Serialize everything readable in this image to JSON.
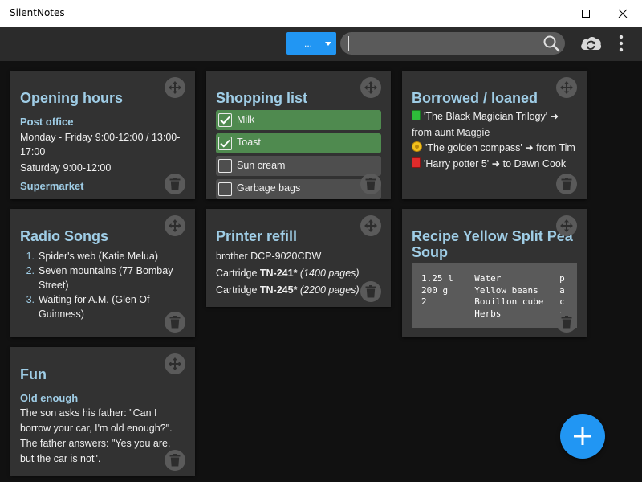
{
  "window": {
    "title": "SilentNotes",
    "minimize_icon": "minimize-icon",
    "maximize_icon": "maximize-icon",
    "close_icon": "close-icon"
  },
  "toolbar": {
    "filter_label": "...",
    "search_value": "",
    "search_placeholder": "",
    "search_icon": "search-icon",
    "sync_icon": "cloud-sync-icon",
    "menu_icon": "more-vertical-icon"
  },
  "notes": {
    "opening_hours": {
      "title": "Opening hours",
      "sections": [
        {
          "heading": "Post office",
          "lines": [
            "Monday - Friday 9:00-12:00 / 13:00-17:00",
            "Saturday 9:00-12:00"
          ]
        },
        {
          "heading": "Supermarket",
          "lines": []
        }
      ]
    },
    "shopping_list": {
      "title": "Shopping list",
      "items": [
        {
          "label": "Milk",
          "checked": true
        },
        {
          "label": "Toast",
          "checked": true
        },
        {
          "label": "Sun cream",
          "checked": false
        },
        {
          "label": "Garbage bags",
          "checked": false
        }
      ]
    },
    "borrowed": {
      "title": "Borrowed / loaned",
      "items": [
        {
          "icon": "green-book-icon",
          "text": "'The Black Magician Trilogy' ➜ from aunt Maggie"
        },
        {
          "icon": "gold-coin-icon",
          "text": "'The golden compass' ➜ from Tim"
        },
        {
          "icon": "red-book-icon",
          "text": "'Harry potter 5' ➜ to Dawn Cook"
        }
      ]
    },
    "radio_songs": {
      "title": "Radio Songs",
      "items": [
        {
          "num": "1.",
          "text": "Spider's web (Katie Melua)"
        },
        {
          "num": "2.",
          "text": "Seven mountains (77 Bombay Street)"
        },
        {
          "num": "3.",
          "text": "Waiting for A.M. (Glen Of Guinness)"
        }
      ]
    },
    "printer_refill": {
      "title": "Printer refill",
      "line1": "brother DCP-9020CDW",
      "cartridges": [
        {
          "prefix": "Cartridge ",
          "model": "TN-241*",
          "pages": "(1400 pages)"
        },
        {
          "prefix": "Cartridge ",
          "model": "TN-245*",
          "pages": "(2200 pages)"
        }
      ]
    },
    "recipe": {
      "title": "Recipe Yellow Split Pea Soup",
      "code": "1.25 l    Water           p\n200 g     Yellow beans    a\n2         Bouillon cube   c\n          Herbs           a"
    },
    "fun": {
      "title": "Fun",
      "heading": "Old enough",
      "text": "The son asks his father: \"Can I borrow your car, I'm old enough?\". The father answers: \"Yes you are, but the car is not\"."
    }
  },
  "fab": {
    "icon": "plus-icon"
  },
  "colors": {
    "accent": "#2196f3",
    "title_blue": "#9fcde6",
    "card_bg": "#323232",
    "checked_bg": "#4f8a4f",
    "unchecked_bg": "#4e4e4e",
    "background": "#111111"
  }
}
